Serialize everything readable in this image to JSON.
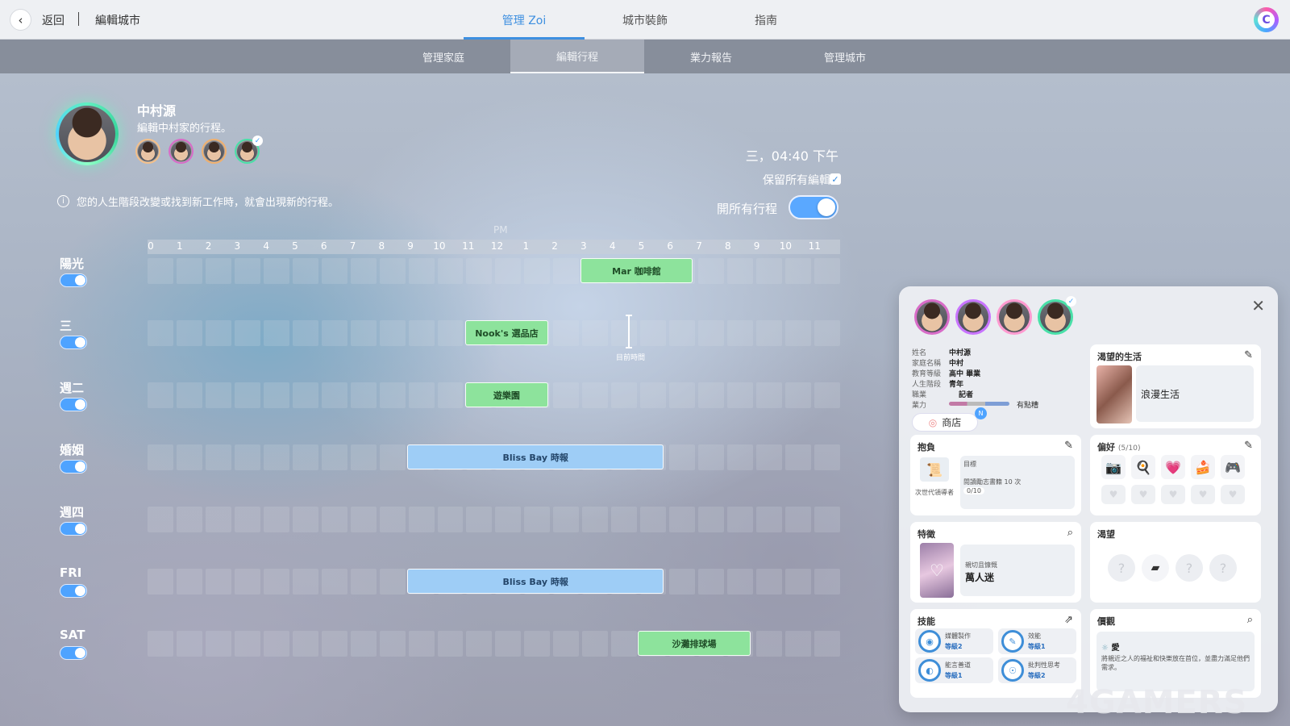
{
  "topbar": {
    "back_label": "返回",
    "crumb": "編輯城市",
    "tabs": [
      {
        "label": "管理 Zoi",
        "active": true
      },
      {
        "label": "城市裝飾",
        "active": false
      },
      {
        "label": "指南",
        "active": false
      }
    ],
    "user_initial": "C"
  },
  "subbar": {
    "tabs": [
      {
        "label": "管理家庭",
        "active": false
      },
      {
        "label": "編輯行程",
        "active": true
      },
      {
        "label": "業力報告",
        "active": false
      },
      {
        "label": "管理城市",
        "active": false
      }
    ]
  },
  "profile": {
    "name": "中村源",
    "subtitle": "編輯中村家的行程。",
    "note": "您的人生階段改變或找到新工作時，就會出現新的行程。"
  },
  "controls": {
    "clock": "三，04:40 下午",
    "keep_edits_label": "保留所有編輯",
    "keep_edits_checked": true,
    "open_all_label": "開所有行程",
    "open_all_on": true
  },
  "timeline": {
    "pm_label": "PM",
    "hours": [
      "0",
      "1",
      "2",
      "3",
      "4",
      "5",
      "6",
      "7",
      "8",
      "9",
      "10",
      "11",
      "12",
      "1",
      "2",
      "3",
      "4",
      "5",
      "6",
      "7",
      "8",
      "9",
      "10",
      "11"
    ],
    "now_label": "目前時間",
    "now_hour": 16.67,
    "rows": [
      {
        "label": "陽光",
        "enabled": true,
        "events": [
          {
            "label": "Mar 咖啡館",
            "start": 15,
            "end": 19,
            "color": "green"
          }
        ]
      },
      {
        "label": "三",
        "enabled": true,
        "events": [
          {
            "label": "Nook's 選品店",
            "start": 11,
            "end": 14,
            "color": "green"
          }
        ]
      },
      {
        "label": "週二",
        "enabled": true,
        "events": [
          {
            "label": "遊樂園",
            "start": 11,
            "end": 14,
            "color": "green"
          }
        ]
      },
      {
        "label": "婚姻",
        "enabled": true,
        "events": [
          {
            "label": "Bliss Bay 時報",
            "start": 9,
            "end": 18,
            "color": "blue"
          }
        ]
      },
      {
        "label": "週四",
        "enabled": true,
        "events": []
      },
      {
        "label": "FRI",
        "enabled": true,
        "events": [
          {
            "label": "Bliss Bay 時報",
            "start": 9,
            "end": 18,
            "color": "blue"
          }
        ]
      },
      {
        "label": "SAT",
        "enabled": true,
        "events": [
          {
            "label": "沙灘排球場",
            "start": 17,
            "end": 21,
            "color": "green"
          }
        ]
      }
    ]
  },
  "panel": {
    "info": [
      {
        "key": "姓名",
        "value": "中村源"
      },
      {
        "key": "家庭名稱",
        "value": "中村"
      },
      {
        "key": "教育等級",
        "value": "高中 畢業"
      },
      {
        "key": "人生階段",
        "value": "青年"
      },
      {
        "key": "職業",
        "value": "記者"
      },
      {
        "key": "業力",
        "value": "有點糟"
      }
    ],
    "shop_label": "商店",
    "shop_badge": "N",
    "desired_life": {
      "title": "渴望的生活",
      "value": "浪漫生活"
    },
    "ambition": {
      "title": "抱負",
      "goal_label": "目標",
      "goal_text": "閱讀勵志書籍 10 次",
      "progress": "0/10",
      "name": "次世代領導者"
    },
    "preferences": {
      "title": "偏好",
      "count": "(5/10)",
      "icons": [
        "📷",
        "🍳",
        "💗",
        "🍰",
        "🎮"
      ]
    },
    "traits": {
      "title": "特徵",
      "sub": "親切且慷慨",
      "value": "萬人迷"
    },
    "desires": {
      "title": "渴望",
      "q": "?"
    },
    "skills": {
      "title": "技能",
      "items": [
        {
          "name": "媒體製作",
          "level": "等級2"
        },
        {
          "name": "效能",
          "level": "等級1"
        },
        {
          "name": "能言善道",
          "level": "等級1"
        },
        {
          "name": "批判性思考",
          "level": "等級2"
        }
      ]
    },
    "values": {
      "title": "價觀",
      "tag": "愛",
      "text": "將親近之人的福祉和快樂放在首位，並盡力滿足他們需求。"
    }
  },
  "watermark": "4GAMERS",
  "colors": {
    "accent": "#3d8fe0",
    "event_green": "#8de39c",
    "event_blue": "#9ecdf6"
  }
}
